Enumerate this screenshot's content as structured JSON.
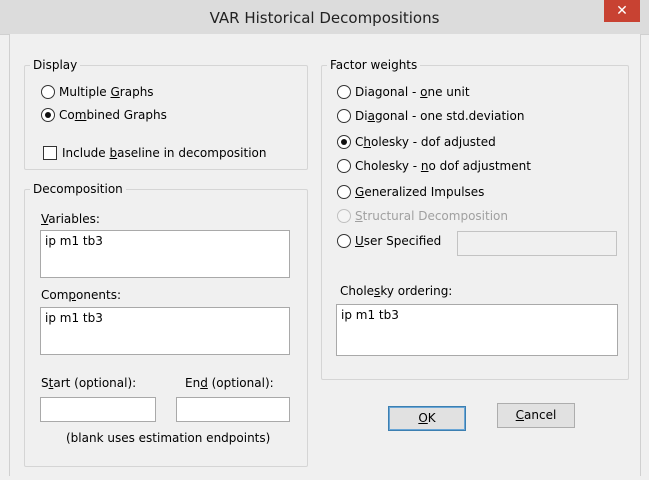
{
  "window": {
    "title": "VAR Historical Decompositions",
    "close_glyph": "✕"
  },
  "display": {
    "legend": "Display",
    "options": [
      {
        "pre": "Multiple ",
        "acc": "G",
        "post": "raphs",
        "checked": false
      },
      {
        "pre": "Co",
        "acc": "m",
        "post": "bined Graphs",
        "checked": true
      }
    ],
    "include_baseline": {
      "pre": "Include ",
      "acc": "b",
      "post": "aseline in decomposition",
      "checked": false
    }
  },
  "decomposition": {
    "legend": "Decomposition",
    "variables_label": {
      "pre": "",
      "acc": "V",
      "post": "ariables:"
    },
    "variables_value": "ip m1 tb3",
    "components_label": {
      "pre": "Com",
      "acc": "p",
      "post": "onents:"
    },
    "components_value": "ip m1 tb3",
    "start_label": {
      "pre": "S",
      "acc": "t",
      "post": "art (optional):"
    },
    "end_label": {
      "pre": "En",
      "acc": "d",
      "post": " (optional):"
    },
    "start_value": "",
    "end_value": "",
    "note": "(blank uses estimation endpoints)"
  },
  "factor_weights": {
    "legend": "Factor weights",
    "options": [
      {
        "pre": "Diagonal - ",
        "acc": "o",
        "post": "ne unit",
        "checked": false,
        "disabled": false
      },
      {
        "pre": "Di",
        "acc": "a",
        "post": "gonal - one std.deviation",
        "checked": false,
        "disabled": false
      },
      {
        "pre": "C",
        "acc": "h",
        "post": "olesky - dof adjusted",
        "checked": true,
        "disabled": false
      },
      {
        "pre": "Cholesky - ",
        "acc": "n",
        "post": "o dof adjustment",
        "checked": false,
        "disabled": false
      },
      {
        "pre": "",
        "acc": "G",
        "post": "eneralized Impulses",
        "checked": false,
        "disabled": false
      },
      {
        "pre": "",
        "acc": "S",
        "post": "tructural Decomposition",
        "checked": false,
        "disabled": true
      },
      {
        "pre": "",
        "acc": "U",
        "post": "ser Specified",
        "checked": false,
        "disabled": false
      }
    ],
    "user_specified_value": "",
    "ordering_label": {
      "pre": "Chole",
      "acc": "s",
      "post": "ky ordering:"
    },
    "ordering_value": "ip m1 tb3"
  },
  "buttons": {
    "ok": {
      "pre": "",
      "acc": "O",
      "post": "K"
    },
    "cancel": {
      "pre": "",
      "acc": "C",
      "post": "ancel"
    }
  }
}
